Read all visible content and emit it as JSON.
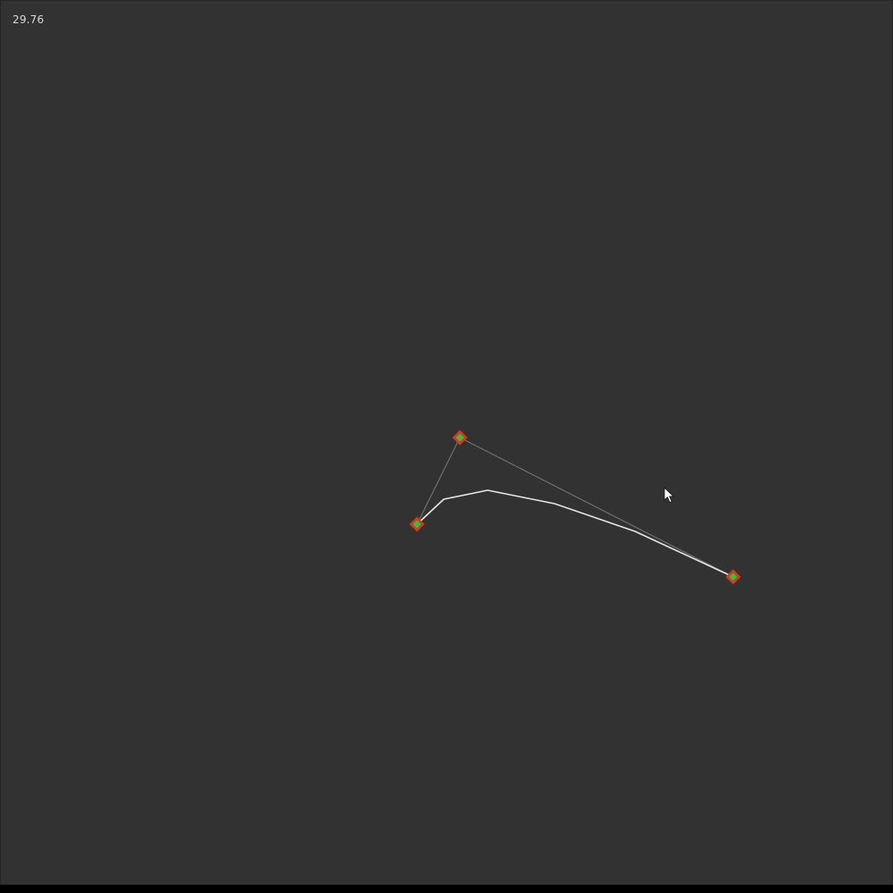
{
  "hud": {
    "fps": "29.76"
  },
  "colors": {
    "background": "#323232",
    "curve": "#e6e6e6",
    "control_polygon": "#7a7a7a",
    "handle_outer": "#d23a1e",
    "handle_inner": "#33c23a"
  },
  "icons": {
    "cursor": "mouse-pointer-icon"
  }
}
